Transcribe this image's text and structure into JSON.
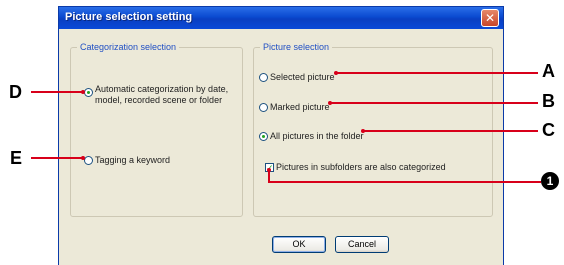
{
  "dialog": {
    "title": "Picture selection setting",
    "close_glyph": "✕",
    "categorization": {
      "title": "Categorization selection",
      "options": [
        {
          "label": "Automatic categorization by date, model, recorded scene or folder",
          "checked": true
        },
        {
          "label": "Tagging a keyword",
          "checked": false
        }
      ]
    },
    "picture_selection": {
      "title": "Picture selection",
      "options": [
        {
          "label": "Selected picture",
          "checked": false
        },
        {
          "label": "Marked picture",
          "checked": false
        },
        {
          "label": "All pictures in the folder",
          "checked": true
        }
      ],
      "subfolders_checkbox": {
        "label": "Pictures in subfolders are also categorized",
        "checked": true,
        "glyph": "✓"
      }
    },
    "buttons": {
      "ok": "OK",
      "cancel": "Cancel"
    }
  },
  "callouts": {
    "A": "A",
    "B": "B",
    "C": "C",
    "D": "D",
    "E": "E",
    "one": "1"
  },
  "colors": {
    "callout_line": "#d8001a",
    "title_bar": "#0a4ad0",
    "group_title": "#2150c4",
    "radio_check": "#21a121"
  }
}
